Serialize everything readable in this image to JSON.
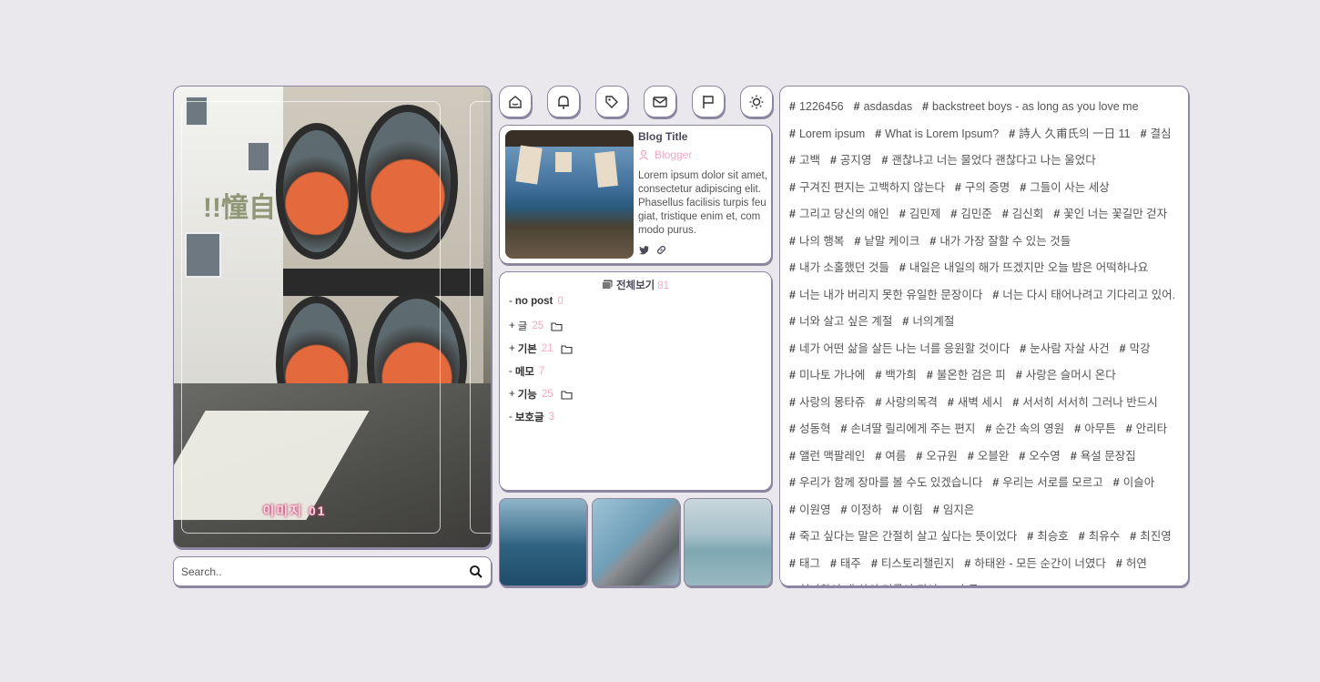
{
  "hero": {
    "caption": "이미지 01",
    "deco_text": "!!憧自"
  },
  "search": {
    "placeholder": "Search.."
  },
  "top_icons": [
    "home-icon",
    "bell-icon",
    "tag-icon",
    "mail-icon",
    "flag-icon",
    "sun-icon"
  ],
  "profile": {
    "title": "Blog Title",
    "role": "Blogger",
    "description": "Lorem ipsum dolor sit amet, consectetur adipiscing elit. Phasellus facilisis turpis feugiat, tristique enim et, commodo purus."
  },
  "categories": {
    "all_label": "전체보기",
    "all_count": "81",
    "items": [
      {
        "prefix": "-",
        "name": "no post",
        "count": "0",
        "folder": false
      },
      {
        "prefix": "+",
        "name": "글",
        "count": "25",
        "folder": true
      },
      {
        "prefix": "+",
        "name": "기본",
        "count": "21",
        "folder": true
      },
      {
        "prefix": "-",
        "name": "메모",
        "count": "7",
        "folder": false
      },
      {
        "prefix": "+",
        "name": "기능",
        "count": "25",
        "folder": true
      },
      {
        "prefix": "-",
        "name": "보호글",
        "count": "3",
        "folder": false
      }
    ]
  },
  "tags": [
    "1226456",
    "asdasdas",
    "backstreet boys - as long as you love me",
    "Lorem ipsum",
    "What is Lorem Ipsum?",
    "詩人 久甫氏의 一日 11",
    "결심",
    "고백",
    "공지영",
    "괜찮냐고 너는 물었다 괜찮다고 나는 울었다",
    "구겨진 편지는 고백하지 않는다",
    "구의 증명",
    "그들이 사는 세상",
    "그리고 당신의 애인",
    "김민제",
    "김민준",
    "김신회",
    "꽃인 너는 꽃길만 걷자",
    "나의 행복",
    "낱말 케이크",
    "내가 가장 잘할 수 있는 것들",
    "내가 소홀했던 것들",
    "내일은 내일의 해가 뜨겠지만 오늘 밤은 어떡하나요",
    "너는 내가 버리지 못한 유일한 문장이다",
    "너는 다시 태어나려고 기다리고 있어.",
    "너와 살고 싶은 계절",
    "너의계절",
    "네가 어떤 삶을 살든 나는 너를 응원할 것이다",
    "눈사람 자살 사건",
    "막강",
    "미나토 가나에",
    "백가희",
    "불온한 검은 피",
    "사랑은 슬머시 온다",
    "사랑의 몽타쥬",
    "사랑의목격",
    "새벽 세시",
    "서서히 서서히 그러나 반드시",
    "성동혁",
    "손녀딸 릴리에게 주는 편지",
    "순간 속의 영원",
    "아무튼",
    "안리타",
    "앨런 맥팔레인",
    "여름",
    "오규원",
    "오블완",
    "오수영",
    "욕설 문장집",
    "우리가 함께 장마를 볼 수도 있겠습니다",
    "우리는 서로를 모르고",
    "이슬아",
    "이원영",
    "이정하",
    "이힘",
    "임지은",
    "죽고 싶다는 말은 간절히 살고 싶다는 뜻이었다",
    "최승호",
    "최유수",
    "최진영",
    "태그",
    "태주",
    "티스토리챌린지",
    "하태완 - 모든 순간이 너였다",
    "허연",
    "헌나함이 내 삶의 거름이 되어",
    "흐금"
  ],
  "colors": {
    "accent_pink": "#f3a8c3",
    "border": "#8c86a0",
    "background": "#eae8ec"
  }
}
